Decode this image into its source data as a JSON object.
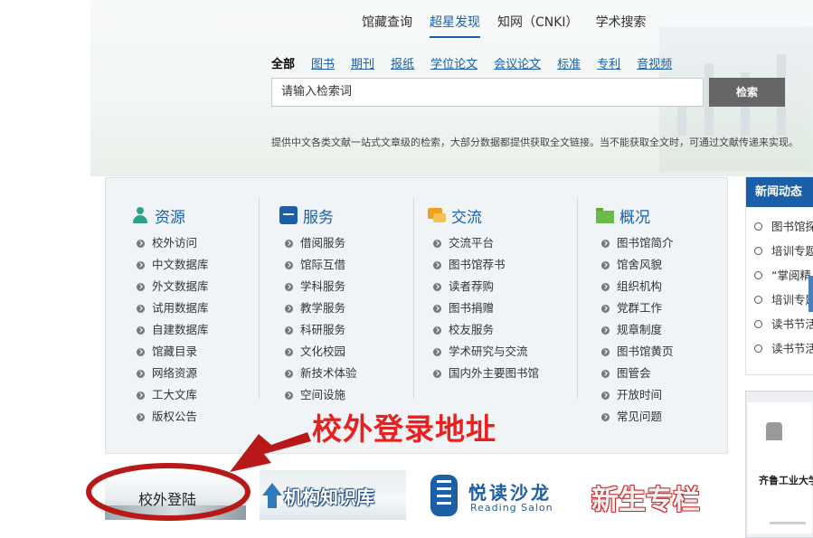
{
  "top_nav": {
    "tabs": [
      "馆藏查询",
      "超星发现",
      "知网（CNKI）",
      "学术搜索"
    ],
    "active_index": 1
  },
  "search": {
    "categories": [
      "全部",
      "图书",
      "期刊",
      "报纸",
      "学位论文",
      "会议论文",
      "标准",
      "专利",
      "音视频"
    ],
    "input_value": "请输入检索词",
    "button_label": "检索",
    "description": "提供中文各类文献一站式文章级的检索，大部分数据都提供获取全文链接。当不能获取全文时，可通过文献传递来实现。"
  },
  "columns": [
    {
      "title": "资源",
      "icon": "person-icon",
      "items": [
        "校外访问",
        "中文数据库",
        "外文数据库",
        "试用数据库",
        "自建数据库",
        "馆藏目录",
        "网络资源",
        "工大文库",
        "版权公告"
      ]
    },
    {
      "title": "服务",
      "icon": "service-box-icon",
      "items": [
        "借阅服务",
        "馆际互借",
        "学科服务",
        "教学服务",
        "科研服务",
        "文化校园",
        "新技术体验",
        "空间设施"
      ]
    },
    {
      "title": "交流",
      "icon": "chat-icon",
      "items": [
        "交流平台",
        "图书馆荐书",
        "读者荐购",
        "图书捐赠",
        "校友服务",
        "学术研究与交流",
        "国内外主要图书馆"
      ]
    },
    {
      "title": "概况",
      "icon": "folder-icon",
      "items": [
        "图书馆简介",
        "馆舍风貌",
        "组织机构",
        "党群工作",
        "规章制度",
        "图书馆黄页",
        "图管会",
        "开放时间",
        "常见问题"
      ]
    }
  ],
  "annotation": {
    "text": "校外登录地址",
    "color": "#e82020"
  },
  "banners": {
    "offcampus_login": "校外登陆",
    "institution_repository": "机构知识库",
    "reading_salon_cn": "悦读沙龙",
    "reading_salon_en": "Reading Salon",
    "freshman": "新生专栏"
  },
  "news": {
    "title": "新闻动态",
    "items": [
      "图书馆探",
      "培训专题",
      "“掌阅精",
      "培训专题",
      "读书节活",
      "读书节活"
    ]
  },
  "side_doc": {
    "title": "齐鲁工业大学图"
  },
  "colors": {
    "brand_blue": "#1a5fa8",
    "search_button": "#666666"
  }
}
